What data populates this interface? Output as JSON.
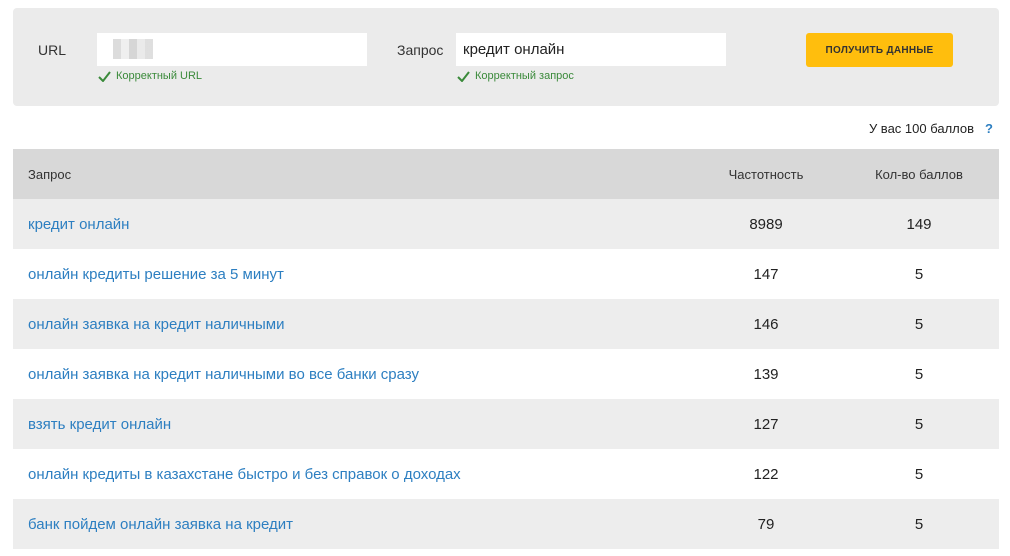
{
  "form": {
    "url_label": "URL",
    "url_value": "",
    "url_valid_text": "Корректный URL",
    "query_label": "Запрос",
    "query_value": "кредит онлайн",
    "query_valid_text": "Корректный запрос",
    "submit_label": "ПОЛУЧИТЬ ДАННЫЕ"
  },
  "balance": {
    "text": "У вас 100 баллов",
    "help": "?"
  },
  "table": {
    "headers": {
      "query": "Запрос",
      "frequency": "Частотность",
      "points": "Кол-во баллов"
    },
    "rows": [
      {
        "query": "кредит онлайн",
        "frequency": "8989",
        "points": "149"
      },
      {
        "query": "онлайн кредиты решение за 5 минут",
        "frequency": "147",
        "points": "5"
      },
      {
        "query": "онлайн заявка на кредит наличными",
        "frequency": "146",
        "points": "5"
      },
      {
        "query": "онлайн заявка на кредит наличными во все банки сразу",
        "frequency": "139",
        "points": "5"
      },
      {
        "query": "взять кредит онлайн",
        "frequency": "127",
        "points": "5"
      },
      {
        "query": "онлайн кредиты в казахстане быстро и без справок о доходах",
        "frequency": "122",
        "points": "5"
      },
      {
        "query": "банк пойдем онлайн заявка на кредит",
        "frequency": "79",
        "points": "5"
      }
    ]
  },
  "colors": {
    "accent_button": "#ffbe0d",
    "link": "#2d7fc1",
    "valid": "#3a8a3a",
    "panel_bg": "#ebebeb",
    "header_bg": "#d8d8d8"
  },
  "icons": {
    "valid": "check-icon",
    "help": "help-icon"
  }
}
